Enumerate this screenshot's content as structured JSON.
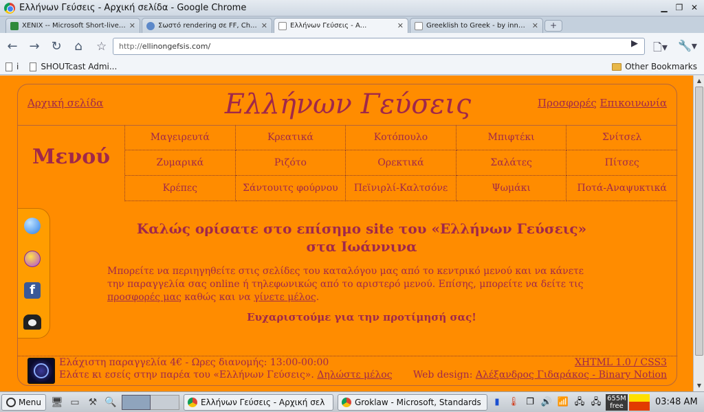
{
  "window": {
    "title": "Ελλήνων Γεύσεις - Αρχική σελίδα - Google Chrome"
  },
  "tabs": [
    {
      "label": "XENIX -- Microsoft Short-lived ...",
      "active": false
    },
    {
      "label": "Σωστό rendering σε FF, Ch...",
      "active": false
    },
    {
      "label": "Ελλήνων Γεύσεις - Α...",
      "active": true
    },
    {
      "label": "Greeklish to Greek - by innoveti...",
      "active": false
    }
  ],
  "toolbar": {
    "url_scheme": "http://",
    "url_host": "ellinongefsis.com/"
  },
  "bookmarks": {
    "item_i": "i",
    "shoutcast": "SHOUTcast Admi...",
    "other": "Other Bookmarks"
  },
  "site": {
    "header": {
      "home": "Αρχική σελίδα",
      "title": "Ελλήνων Γεύσεις",
      "offers": "Προσφορές",
      "contact": "Επικοινωνία"
    },
    "menu_label": "Μενού",
    "menu_items": [
      "Μαγειρευτά",
      "Κρεατικά",
      "Κοτόπουλο",
      "Μπιφτέκι",
      "Σνίτσελ",
      "Ζυμαρικά",
      "Ριζότο",
      "Ορεκτικά",
      "Σαλάτες",
      "Πίτσες",
      "Κρέπες",
      "Σάντουιτς φούρνου",
      "Πεϊνιρλί-Καλτσόνε",
      "Ψωμάκι",
      "Ποτά-Αναψυκτικά"
    ],
    "welcome_line1": "Καλώς ορίσατε στο επίσημο site του «Ελλήνων Γεύσεις»",
    "welcome_line2": "στα Ιωάννινα",
    "intro_text": "Μπορείτε να περιηγηθείτε στις σελίδες του καταλόγου μας από το κεντρικό μενού και να κάνετε την παραγγελία σας online ή τηλεφωνικώς από το αριστερό μενού. Επίσης, μπορείτε να δείτε τις ",
    "intro_link_offers": "προσφορές μας",
    "intro_mid": " καθώς και να ",
    "intro_link_member": "γίνετε μέλος",
    "intro_end": ".",
    "thanks": "Ευχαριστούμε για την προτίμησή σας!",
    "footer": {
      "min_order": "Ελάχιστη παραγγελία 4€ - Ωρες διανομής: 13:00-00:00",
      "join_text": "Ελάτε κι εσείς στην παρέα του «Ελλήνων Γεύσεις».",
      "join_link": "Δηλώστε μέλος",
      "tech": "XHTML 1.0 / CSS3",
      "design_label": "Web design:",
      "design_link": "Αλέξανδρος Γιδαράκος - Binary Notion"
    }
  },
  "taskbar": {
    "menu": "Menu",
    "task1": "Ελλήνων Γεύσεις - Αρχική σελ",
    "task2": "Groklaw - Microsoft, Standards",
    "mem_top": "655M",
    "mem_bottom": "free",
    "clock": "03:48 AM"
  }
}
